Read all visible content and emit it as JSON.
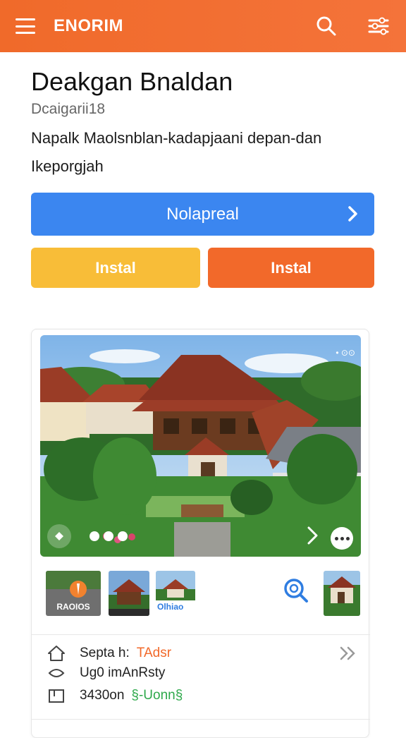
{
  "header": {
    "brand": "ENORIM",
    "menu_icon": "hamburger-menu-icon",
    "search_icon": "search-icon",
    "filter_icon": "filter-sliders-icon",
    "color": "#f06a2a"
  },
  "listing": {
    "title": "Deakgan Bnaldan",
    "subtitle": "Dcaigarii18",
    "description": "Napalk Maolsnblan-kadapjaani depan-dan Ikeporgjah"
  },
  "actions": {
    "primary_label": "Nolapreal",
    "primary_color": "#3b86f0",
    "secondary_left_label": "Instal",
    "secondary_left_color": "#f8bd38",
    "secondary_right_label": "Instal",
    "secondary_right_color": "#f2692a"
  },
  "gallery": {
    "top_icons": "• ⊙⊙",
    "thumbnails": [
      {
        "label": "RAOIOS",
        "label_color": "#ffffff"
      },
      {
        "label": "",
        "label_color": "#f5c518"
      },
      {
        "label": "Olhiao",
        "label_color": "#2f7de1"
      },
      {
        "label": "",
        "label_color": "#ffffff"
      }
    ]
  },
  "details": {
    "rows": [
      {
        "icon": "home-icon",
        "text": "Septa h:",
        "accent": "TAdsr",
        "accent_color": "#f2692a"
      },
      {
        "icon": "location-icon",
        "text": "Ug0 imAnRsty",
        "accent": "",
        "accent_color": "#222222"
      },
      {
        "icon": "size-icon",
        "text": "3430on",
        "accent": "§-Uonn§",
        "accent_color": "#2da84a"
      }
    ]
  }
}
